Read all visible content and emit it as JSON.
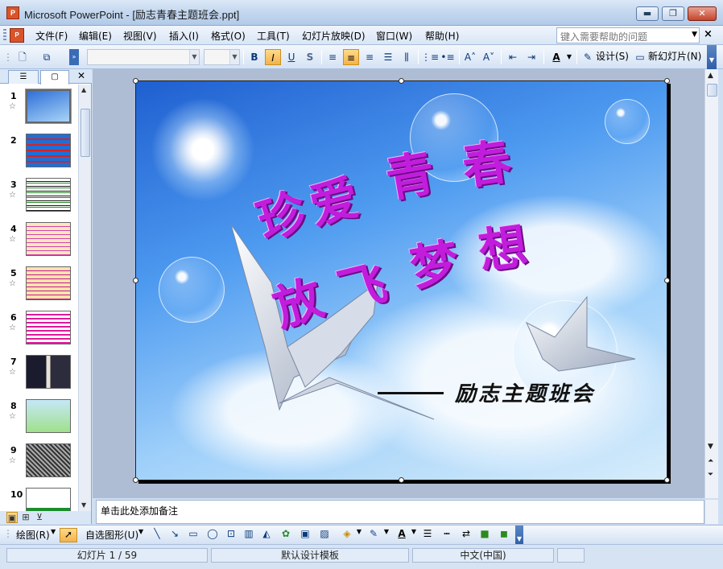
{
  "window": {
    "app_icon_text": "P",
    "title": "Microsoft PowerPoint - [励志青春主题班会.ppt]",
    "min_label": "▬",
    "restore_label": "❐",
    "close_label": "✕"
  },
  "menu": {
    "doc_icon_text": "P",
    "items": [
      "文件(F)",
      "编辑(E)",
      "视图(V)",
      "插入(I)",
      "格式(O)",
      "工具(T)",
      "幻灯片放映(D)",
      "窗口(W)",
      "帮助(H)"
    ],
    "help_placeholder": "键入需要帮助的问题",
    "close_label": "×"
  },
  "toolbar": {
    "font_name": "",
    "font_size": "",
    "bold": "B",
    "italic": "I",
    "underline": "U",
    "shadow": "S",
    "design_label": "设计(S)",
    "new_slide_label": "新幻灯片(N)"
  },
  "outline_tabs": {
    "outline_icon": "☰",
    "slides_icon": "▢",
    "close_label": "✕"
  },
  "slides": [
    {
      "number": "1",
      "star": "☆"
    },
    {
      "number": "2",
      "star": ""
    },
    {
      "number": "3",
      "star": "☆"
    },
    {
      "number": "4",
      "star": "☆"
    },
    {
      "number": "5",
      "star": "☆"
    },
    {
      "number": "6",
      "star": "☆"
    },
    {
      "number": "7",
      "star": "☆"
    },
    {
      "number": "8",
      "star": "☆"
    },
    {
      "number": "9",
      "star": "☆"
    },
    {
      "number": "10",
      "star": ""
    }
  ],
  "slide": {
    "title_line1": [
      "珍",
      "爱",
      "青",
      "春"
    ],
    "title_line2": [
      "放",
      "飞",
      "梦",
      "想"
    ],
    "subtitle": "励志主题班会",
    "title_color": "#c21ddc"
  },
  "notes": {
    "placeholder": "单击此处添加备注"
  },
  "drawing": {
    "draw_label": "绘图(R)",
    "autoshapes_label": "自选图形(U)"
  },
  "status": {
    "slide_position": "幻灯片 1 / 59",
    "template": "默认设计模板",
    "language": "中文(中国)"
  }
}
